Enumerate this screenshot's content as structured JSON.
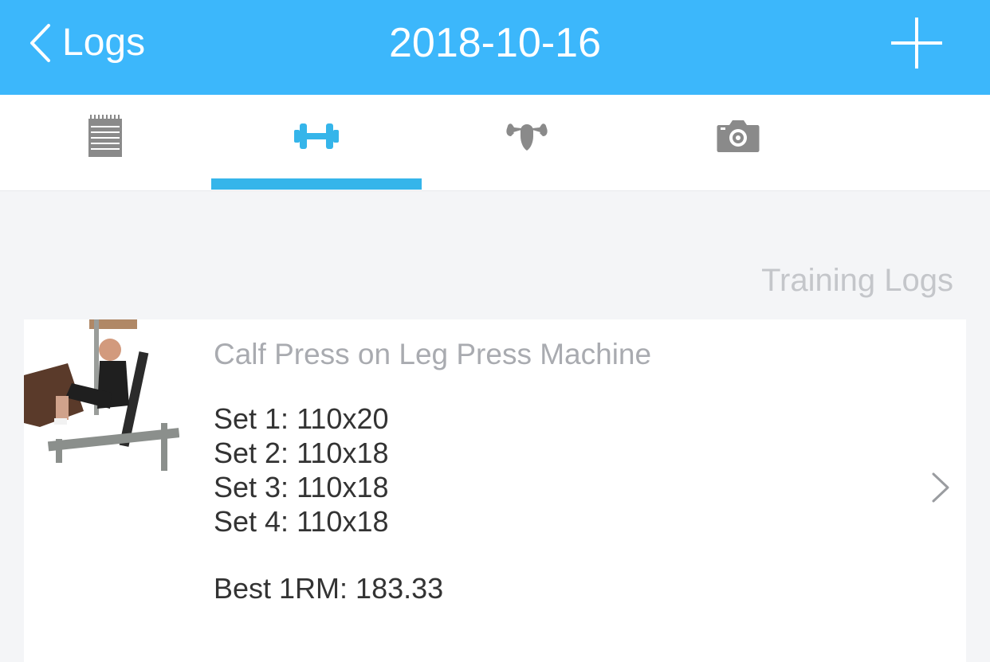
{
  "header": {
    "back_label": "Logs",
    "title": "2018-10-16",
    "add_icon": "plus-icon"
  },
  "tabs": [
    {
      "icon": "notepad-icon",
      "selected": false
    },
    {
      "icon": "dumbbell-icon",
      "selected": true
    },
    {
      "icon": "flexed-muscles-icon",
      "selected": false
    },
    {
      "icon": "camera-icon",
      "selected": false
    }
  ],
  "section_title": "Training Logs",
  "log_entry": {
    "exercise_name": "Calf Press on Leg Press Machine",
    "sets": [
      "Set 1: 110x20",
      "Set 2: 110x18",
      "Set 3: 110x18",
      "Set 4: 110x18"
    ],
    "best_1rm": "Best 1RM: 183.33"
  },
  "colors": {
    "header_bg": "#3cb7fb",
    "accent": "#35b5ea",
    "inactive_icon": "#8a8a8a",
    "muted_text": "#c4c6ca",
    "background": "#f4f5f7"
  }
}
